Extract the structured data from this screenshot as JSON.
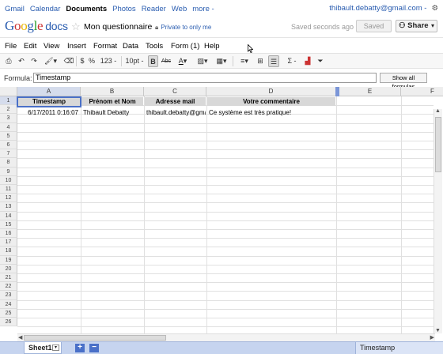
{
  "topnav": {
    "links": [
      "Gmail",
      "Calendar",
      "Documents",
      "Photos",
      "Reader",
      "Web",
      "more -"
    ],
    "active_index": 2,
    "user_email": "thibault.debatty@gmail.com -"
  },
  "titlebar": {
    "logo_google": [
      "G",
      "o",
      "o",
      "g",
      "l",
      "e"
    ],
    "logo_docs": "docs",
    "doc_title": "Mon questionnaire",
    "privacy": "Private to only me",
    "saved_status": "Saved seconds ago",
    "saved_button": "Saved",
    "share_button": "Share"
  },
  "menubar": [
    "File",
    "Edit",
    "View",
    "Insert",
    "Format",
    "Data",
    "Tools",
    "Form (1)",
    "Help"
  ],
  "toolbar": {
    "currency": "$",
    "percent": "%",
    "number_format": "123 -",
    "font_size": "10pt -",
    "bold": "B",
    "strike": "Abc",
    "sum": "Σ -"
  },
  "formula": {
    "label": "Formula:",
    "value": "Timestamp",
    "show_all": "Show all formulas"
  },
  "sheet": {
    "columns": [
      "A",
      "B",
      "C",
      "D",
      "E",
      "F"
    ],
    "row_numbers": [
      "1",
      "2",
      "3",
      "4",
      "5",
      "6",
      "7",
      "8",
      "9",
      "10",
      "11",
      "12",
      "13",
      "14",
      "15",
      "16",
      "17",
      "18",
      "19",
      "20",
      "21",
      "22",
      "23",
      "24",
      "25",
      "26"
    ],
    "header_row": [
      "Timestamp",
      "Prénom et Nom",
      "Adresse mail",
      "Votre commentaire"
    ],
    "data_row": [
      "6/17/2011 0:16:07",
      "Thibault Debatty",
      "thibault.debatty@gmail.com",
      "Ce système est très pratique!"
    ]
  },
  "bottombar": {
    "sheet_tab": "Sheet1",
    "add": "+",
    "remove": "−",
    "summary": "Timestamp"
  },
  "colors": {
    "accent": "#4a70c8",
    "link": "#2a5db0",
    "header_fill": "#d8d8d8"
  }
}
